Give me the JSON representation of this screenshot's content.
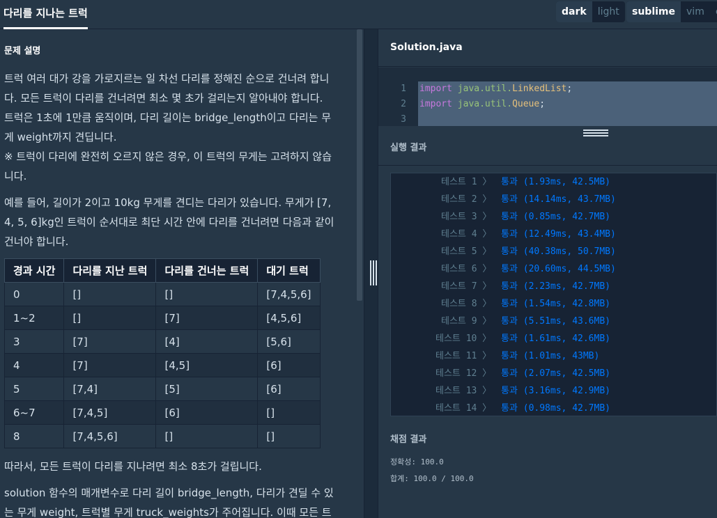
{
  "header": {
    "title": "다리를 지나는 트럭",
    "theme_options": [
      "dark",
      "light"
    ],
    "keymap_options": [
      "sublime",
      "vim",
      "er"
    ]
  },
  "problem": {
    "section_title": "문제 설명",
    "paragraphs": [
      [
        "트럭 여러 대가 강을 가로지르는 일 차선 다리를 정해진 순으로 건너려 합니",
        "다. 모든 트럭이 다리를 건너려면 최소 몇 초가 걸리는지 알아내야 합니다.",
        "트럭은 1초에 1만큼 움직이며, 다리 길이는 bridge_length이고 다리는 무",
        "게 weight까지 견딥니다.",
        "※ 트럭이 다리에 완전히 오르지 않은 경우, 이 트럭의 무게는 고려하지 않습",
        "니다."
      ],
      [
        "예를 들어, 길이가 2이고 10kg 무게를 견디는 다리가 있습니다. 무게가 [7,",
        "4, 5, 6]kg인 트럭이 순서대로 최단 시간 안에 다리를 건너려면 다음과 같이",
        "건너야 합니다."
      ]
    ],
    "table": {
      "headers": [
        "경과 시간",
        "다리를 지난 트럭",
        "다리를 건너는 트럭",
        "대기 트럭"
      ],
      "rows": [
        [
          "0",
          "[]",
          "[]",
          "[7,4,5,6]"
        ],
        [
          "1~2",
          "[]",
          "[7]",
          "[4,5,6]"
        ],
        [
          "3",
          "[7]",
          "[4]",
          "[5,6]"
        ],
        [
          "4",
          "[7]",
          "[4,5]",
          "[6]"
        ],
        [
          "5",
          "[7,4]",
          "[5]",
          "[6]"
        ],
        [
          "6~7",
          "[7,4,5]",
          "[6]",
          "[]"
        ],
        [
          "8",
          "[7,4,5,6]",
          "[]",
          "[]"
        ]
      ]
    },
    "after_table": "따라서, 모든 트럭이 다리를 지나려면 최소 8초가 걸립니다.",
    "last_paragraph": [
      "solution 함수의 매개변수로 다리 길이 bridge_length, 다리가 견딜 수 있",
      "는 무게 weight, 트럭별 무게 truck_weights가 주어집니다. 이때 모든 트"
    ]
  },
  "editor": {
    "filename": "Solution.java",
    "lines": [
      {
        "num": "1",
        "kw": "import",
        "pkg": "java.util.",
        "cls": "LinkedList",
        "end": ";"
      },
      {
        "num": "2",
        "kw": "import",
        "pkg": "java.util.",
        "cls": "Queue",
        "end": ";"
      },
      {
        "num": "3",
        "kw": "",
        "pkg": "",
        "cls": "",
        "end": ""
      }
    ]
  },
  "results": {
    "title": "실행 결과",
    "tests": [
      {
        "label": "테스트 1 〉",
        "status": "통과",
        "detail": " (1.93ms, 42.5MB)"
      },
      {
        "label": "테스트 2 〉",
        "status": "통과",
        "detail": " (14.14ms, 43.7MB)"
      },
      {
        "label": "테스트 3 〉",
        "status": "통과",
        "detail": " (0.85ms, 42.7MB)"
      },
      {
        "label": "테스트 4 〉",
        "status": "통과",
        "detail": " (12.49ms, 43.4MB)"
      },
      {
        "label": "테스트 5 〉",
        "status": "통과",
        "detail": " (40.38ms, 50.7MB)"
      },
      {
        "label": "테스트 6 〉",
        "status": "통과",
        "detail": " (20.60ms, 44.5MB)"
      },
      {
        "label": "테스트 7 〉",
        "status": "통과",
        "detail": " (2.23ms, 42.7MB)"
      },
      {
        "label": "테스트 8 〉",
        "status": "통과",
        "detail": " (1.54ms, 42.8MB)"
      },
      {
        "label": "테스트 9 〉",
        "status": "통과",
        "detail": " (5.51ms, 43.6MB)"
      },
      {
        "label": "테스트 10 〉",
        "status": "통과",
        "detail": " (1.61ms, 42.6MB)"
      },
      {
        "label": "테스트 11 〉",
        "status": "통과",
        "detail": " (1.01ms, 43MB)"
      },
      {
        "label": "테스트 12 〉",
        "status": "통과",
        "detail": " (2.07ms, 42.5MB)"
      },
      {
        "label": "테스트 13 〉",
        "status": "통과",
        "detail": " (3.16ms, 42.9MB)"
      },
      {
        "label": "테스트 14 〉",
        "status": "통과",
        "detail": " (0.98ms, 42.7MB)"
      }
    ]
  },
  "grading": {
    "title": "채점 결과",
    "accuracy": "정확성: 100.0",
    "total": "합계: 100.0 / 100.0"
  }
}
